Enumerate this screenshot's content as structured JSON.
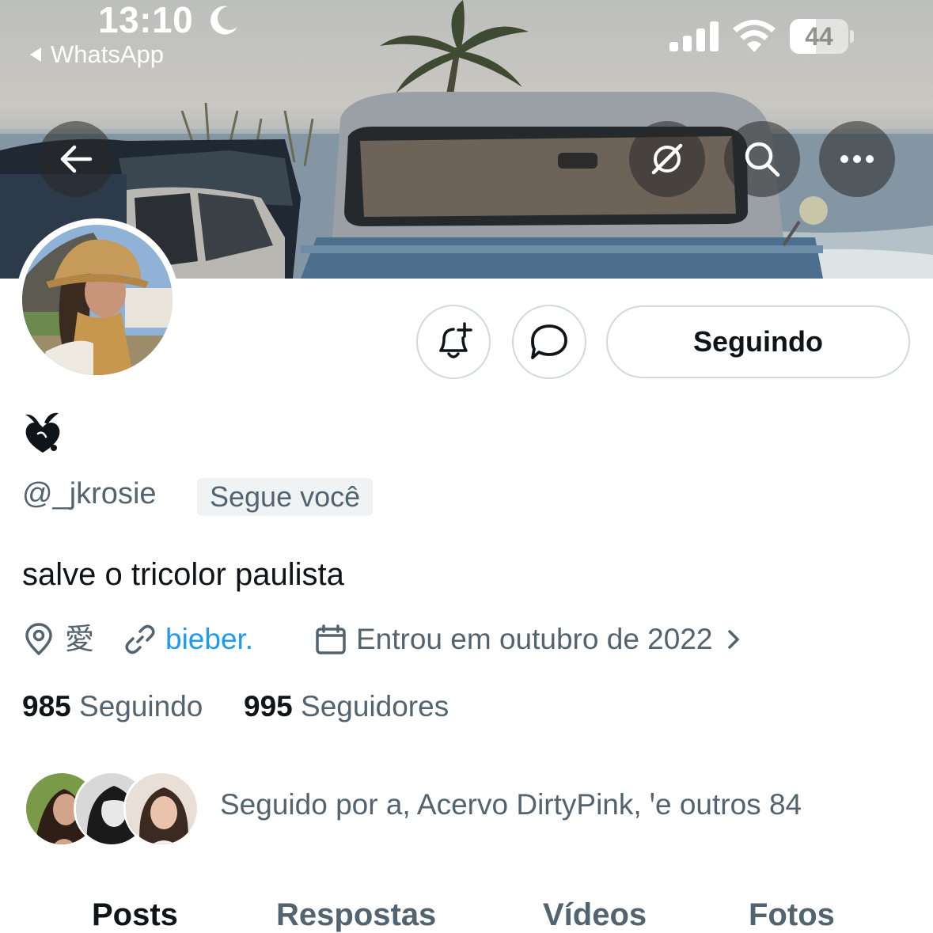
{
  "status_bar": {
    "time": "13:10",
    "back_app": "WhatsApp",
    "battery": "44",
    "battery_level": 0.44
  },
  "banner_buttons": {
    "back": "arrow-left-icon",
    "grok": "grok-icon",
    "search": "search-icon",
    "more": "more-icon"
  },
  "actions": {
    "follow_label": "Seguindo"
  },
  "profile": {
    "display_name": "❦",
    "handle": "@_jkrosie",
    "follows_you": "Segue você",
    "bio": "salve o tricolor paulista",
    "location": "愛",
    "website": "bieber.",
    "joined": "Entrou em outubro de 2022",
    "following_count": "985",
    "following_label": "Seguindo",
    "followers_count": "995",
    "followers_label": "Seguidores",
    "followed_by": "Seguido por a, Acervo DirtyPink, ꞌe outros 84"
  },
  "tabs": [
    "Posts",
    "Respostas",
    "Vídeos",
    "Fotos"
  ],
  "colors": {
    "accent_link": "#1d9bf0",
    "secondary_text": "#536471",
    "primary_text": "#0f1419",
    "border": "#cfd9de"
  }
}
